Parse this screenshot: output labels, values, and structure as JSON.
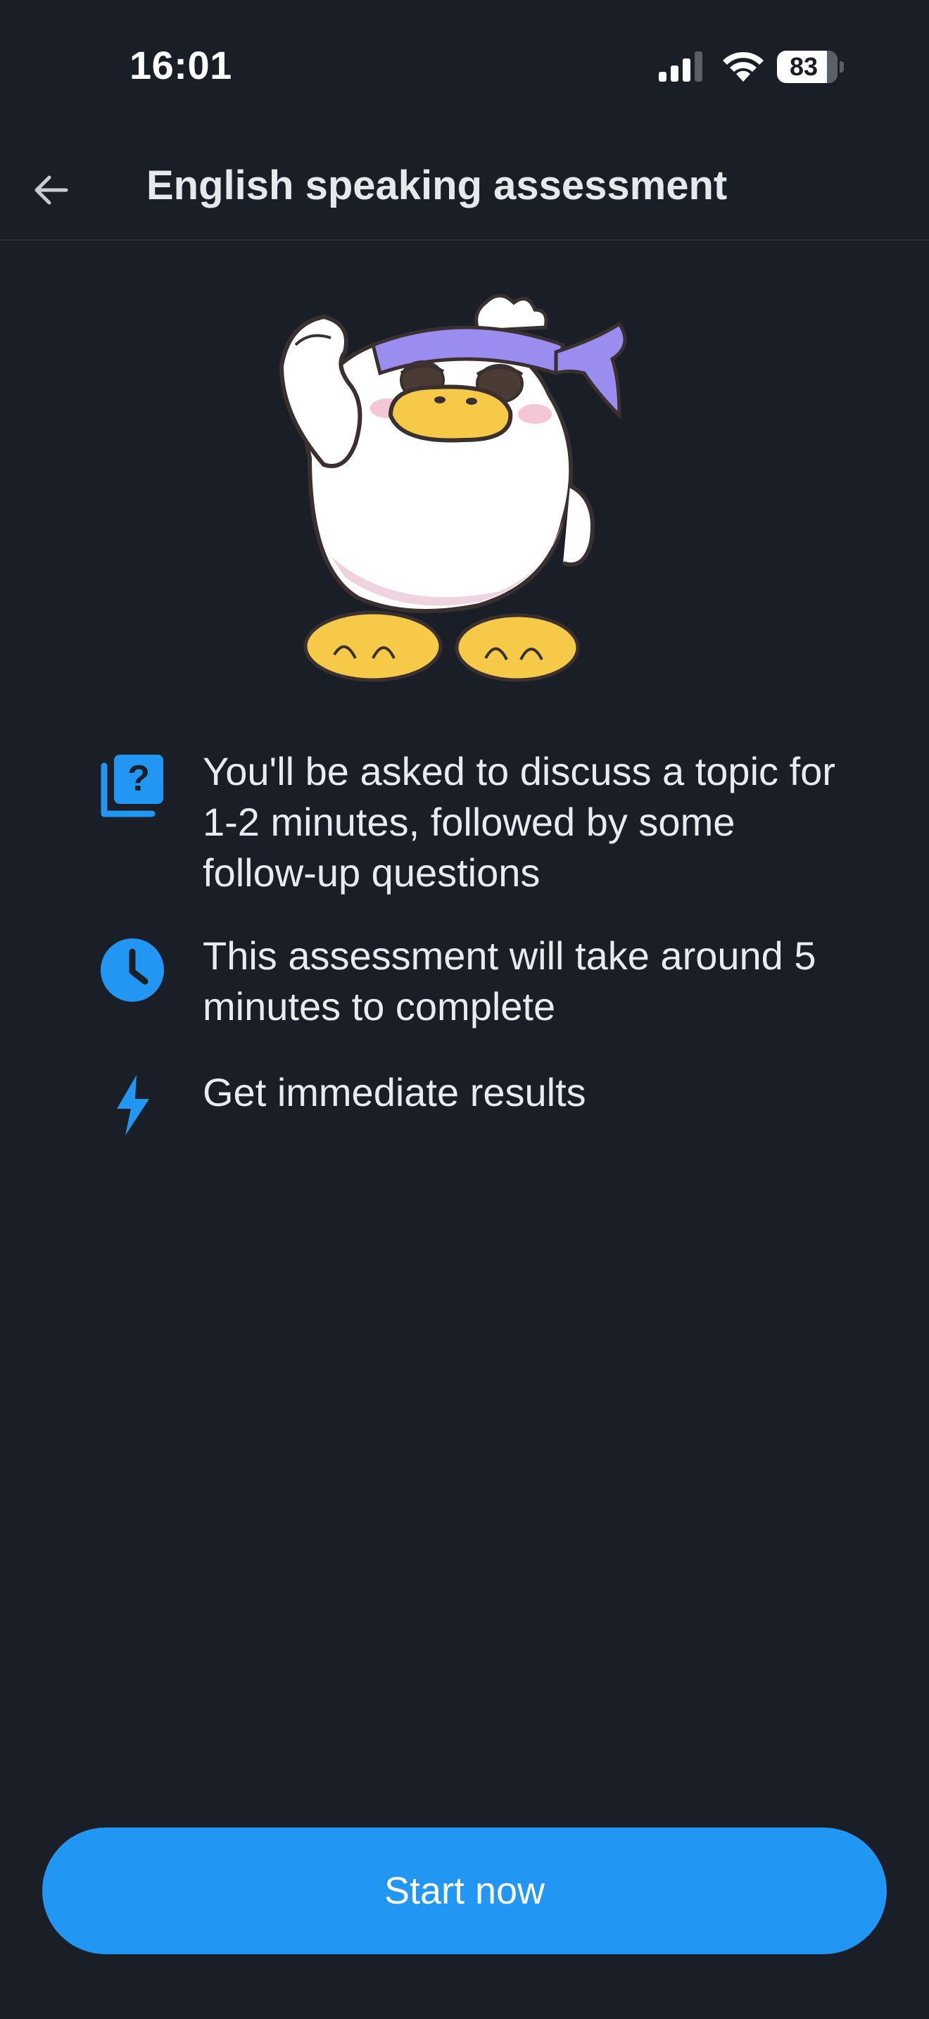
{
  "status_bar": {
    "time": "16:01",
    "battery_level": "83",
    "battery_fraction": 0.83,
    "signal_icon": "cellular-signal-icon",
    "wifi_icon": "wifi-icon",
    "battery_icon": "battery-icon"
  },
  "header": {
    "back_icon": "arrow-left-icon",
    "title": "English speaking assessment"
  },
  "mascot": {
    "icon": "duck-mascot-illustration"
  },
  "features": [
    {
      "icon": "question-card-icon",
      "text": "You'll be asked to discuss a topic for 1-2 minutes, followed by some follow-up questions"
    },
    {
      "icon": "clock-icon",
      "text": "This assessment will take around 5 minutes to complete"
    },
    {
      "icon": "lightning-icon",
      "text": "Get immediate results"
    }
  ],
  "cta": {
    "label": "Start now"
  },
  "colors": {
    "background": "#1a1f27",
    "accent": "#2196f3",
    "text": "#e9ecef",
    "divider": "#2c323c"
  }
}
